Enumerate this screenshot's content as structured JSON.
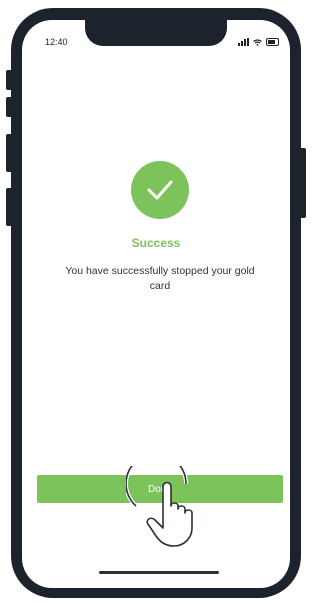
{
  "status_bar": {
    "time": "12:40"
  },
  "success": {
    "title": "Success",
    "message": "You have successfully stopped your gold card"
  },
  "actions": {
    "done_label": "Done"
  },
  "colors": {
    "accent": "#7cc35b",
    "phone_frame": "#1d232c",
    "text": "#333333"
  },
  "icons": {
    "status": "check-icon",
    "gesture": "tap-hand-icon"
  }
}
